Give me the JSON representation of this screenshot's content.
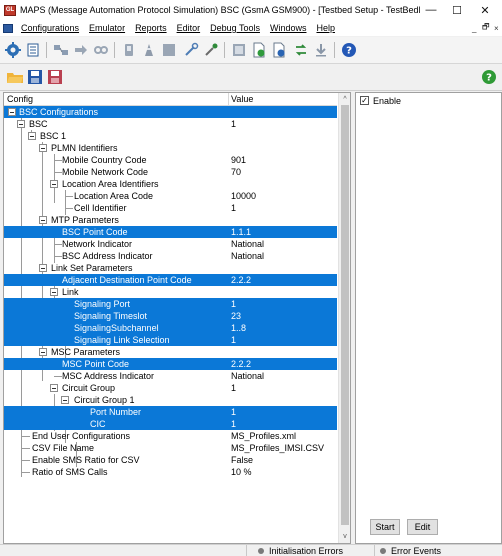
{
  "window": {
    "title": "MAPS (Message Automation Protocol Simulation) BSC (GsmA GSM900) - [Testbed Setup - TestBedDe...",
    "app_icon_text": "GL",
    "minimize": "—",
    "maximize": "☐",
    "close": "✕"
  },
  "menu": {
    "items": [
      "Configurations",
      "Emulator",
      "Reports",
      "Editor",
      "Debug Tools",
      "Windows",
      "Help"
    ],
    "child_min": "_",
    "child_restore": "🗗",
    "child_close": "×"
  },
  "toolbar": {
    "help_icon": "?",
    "green_icon": "?"
  },
  "tree": {
    "col_config": "Config",
    "col_value": "Value",
    "scroll_up": "^",
    "scroll_down": "v",
    "rows": [
      {
        "label": "BSC Configurations",
        "value": ""
      },
      {
        "label": "BSC",
        "value": "1"
      },
      {
        "label": "BSC 1",
        "value": ""
      },
      {
        "label": "PLMN Identifiers",
        "value": ""
      },
      {
        "label": "Mobile Country Code",
        "value": "901"
      },
      {
        "label": "Mobile Network Code",
        "value": "70"
      },
      {
        "label": "Location Area Identifiers",
        "value": ""
      },
      {
        "label": "Location Area Code",
        "value": "10000"
      },
      {
        "label": "Cell Identifier",
        "value": "1"
      },
      {
        "label": "MTP Parameters",
        "value": ""
      },
      {
        "label": "BSC Point Code",
        "value": "1.1.1"
      },
      {
        "label": "Network Indicator",
        "value": "National"
      },
      {
        "label": "BSC Address Indicator",
        "value": "National"
      },
      {
        "label": "Link Set Parameters",
        "value": ""
      },
      {
        "label": "Adjacent Destination Point Code",
        "value": "2.2.2"
      },
      {
        "label": "Link",
        "value": ""
      },
      {
        "label": "Signaling Port",
        "value": "1"
      },
      {
        "label": "Signaling Timeslot",
        "value": "23"
      },
      {
        "label": "SignalingSubchannel",
        "value": "1..8"
      },
      {
        "label": "Signaling Link Selection",
        "value": "1"
      },
      {
        "label": "MSC Parameters",
        "value": ""
      },
      {
        "label": "MSC Point Code",
        "value": "2.2.2"
      },
      {
        "label": "MSC Address Indicator",
        "value": "National"
      },
      {
        "label": "Circuit Group",
        "value": "1"
      },
      {
        "label": "Circuit Group 1",
        "value": ""
      },
      {
        "label": "Port Number",
        "value": "1"
      },
      {
        "label": "CIC",
        "value": "1"
      },
      {
        "label": "End User Configurations",
        "value": "MS_Profiles.xml"
      },
      {
        "label": "CSV File Name",
        "value": "MS_Profiles_IMSI.CSV"
      },
      {
        "label": "Enable SMS Ratio for CSV",
        "value": "False"
      },
      {
        "label": "Ratio of SMS Calls",
        "value": "10 %"
      }
    ]
  },
  "right": {
    "enable_check": "✓",
    "enable_label": "Enable",
    "start": "Start",
    "edit": "Edit"
  },
  "status": {
    "init_errors": "Initialisation Errors",
    "error_events": "Error Events"
  }
}
